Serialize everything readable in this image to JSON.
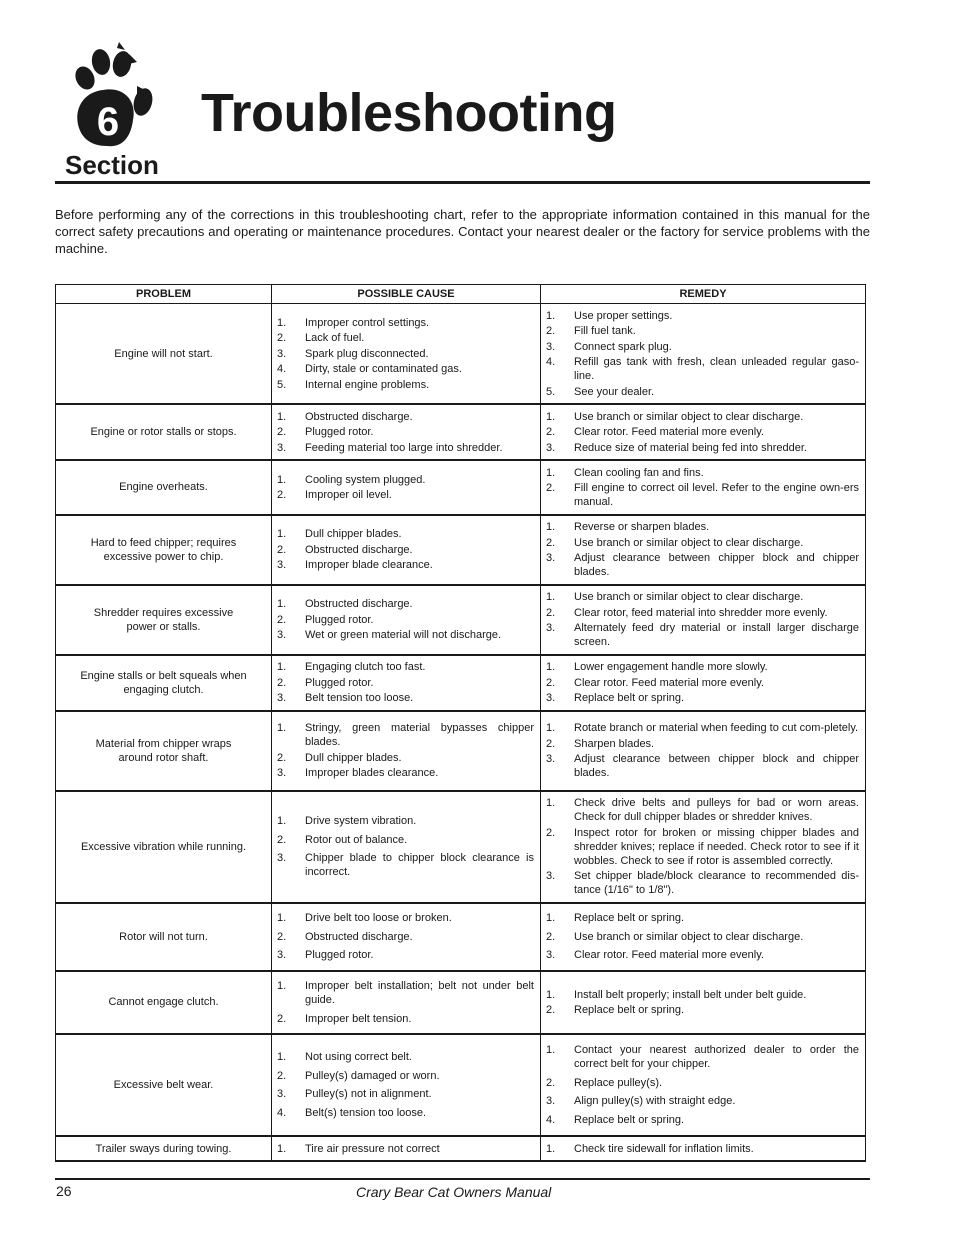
{
  "header": {
    "section_number": "6",
    "section_label": "Section",
    "title": "Troubleshooting"
  },
  "intro": "Before performing any of the corrections in this troubleshooting chart, refer to the appropriate information contained in this manual for the correct safety precautions and operating or maintenance procedures.  Contact your nearest dealer or the factory for service problems with the machine.",
  "table": {
    "headers": [
      "PROBLEM",
      "POSSIBLE CAUSE",
      "REMEDY"
    ],
    "rows": [
      {
        "problem": "Engine will not start.",
        "causes": [
          "Improper control settings.",
          "Lack of fuel.",
          "Spark plug disconnected.",
          "Dirty, stale or contaminated gas.",
          "Internal engine problems."
        ],
        "remedies": [
          "Use proper settings.",
          "Fill fuel tank.",
          "Connect spark plug.",
          "Refill gas tank with fresh, clean unleaded regular gaso-line.",
          "See your dealer."
        ]
      },
      {
        "problem": "Engine or rotor stalls or stops.",
        "causes": [
          "Obstructed discharge.",
          "Plugged rotor.",
          "Feeding material too large into shredder."
        ],
        "remedies": [
          "Use branch or similar object to clear discharge.",
          "Clear rotor.  Feed material more evenly.",
          "Reduce size of material being fed into shredder."
        ]
      },
      {
        "problem": "Engine overheats.",
        "causes": [
          "Cooling system plugged.",
          "Improper oil level."
        ],
        "remedies": [
          "Clean cooling fan and fins.",
          "Fill engine to correct oil level.  Refer to the engine own-ers manual."
        ]
      },
      {
        "problem": "Hard to feed chipper; requires excessive power to chip.",
        "causes": [
          "Dull chipper blades.",
          "Obstructed discharge.",
          "Improper blade clearance."
        ],
        "remedies": [
          "Reverse or sharpen blades.",
          "Use branch or similar object to clear discharge.",
          "Adjust clearance between chipper block and chipper blades."
        ]
      },
      {
        "problem": "Shredder requires excessive power or stalls.",
        "causes": [
          "Obstructed discharge.",
          "Plugged rotor.",
          "Wet or green material will not discharge."
        ],
        "remedies": [
          "Use branch or similar object to clear discharge.",
          "Clear rotor, feed material into shredder more evenly.",
          "Alternately feed dry material or install larger discharge screen."
        ]
      },
      {
        "problem": "Engine stalls or belt squeals when engaging clutch.",
        "causes": [
          "Engaging clutch too fast.",
          "Plugged rotor.",
          "Belt tension too loose."
        ],
        "remedies": [
          "Lower engagement handle more slowly.",
          "Clear rotor.  Feed material more evenly.",
          "Replace belt or spring."
        ]
      },
      {
        "problem": "Material from chipper wraps around rotor shaft.",
        "causes": [
          "Stringy, green material bypasses chipper blades.",
          "Dull chipper blades.",
          "Improper blades clearance."
        ],
        "remedies": [
          "Rotate branch or material when feeding to cut com-pletely.",
          "Sharpen blades.",
          "Adjust clearance between chipper block and chipper blades."
        ]
      },
      {
        "problem": "Excessive vibration while running.",
        "causes": [
          "Drive system vibration.",
          "Rotor out of balance.",
          "Chipper blade to chipper block clearance is incorrect."
        ],
        "remedies": [
          "Check drive belts and pulleys for bad or worn areas.  Check for dull chipper blades or shredder knives.",
          "Inspect rotor for broken or missing chipper blades and shredder knives; replace if needed.  Check rotor to see if it wobbles.  Check to see if rotor is assembled correctly.",
          "Set chipper blade/block clearance to recommended dis-tance (1/16\" to 1/8\")."
        ]
      },
      {
        "problem": "Rotor will not turn.",
        "causes": [
          "Drive belt too loose or broken.",
          "Obstructed discharge.",
          "Plugged rotor."
        ],
        "remedies": [
          "Replace belt or spring.",
          "Use branch or similar object to clear discharge.",
          "Clear rotor.  Feed material more evenly."
        ]
      },
      {
        "problem": "Cannot engage clutch.",
        "causes": [
          "Improper belt installation; belt not under belt guide.",
          "Improper belt tension."
        ],
        "remedies": [
          "Install belt properly; install belt under belt guide.",
          "Replace belt or spring."
        ]
      },
      {
        "problem": "Excessive belt wear.",
        "causes": [
          "Not using correct belt.",
          "Pulley(s) damaged or worn.",
          "Pulley(s) not in alignment.",
          "Belt(s) tension too loose."
        ],
        "remedies": [
          "Contact your nearest authorized dealer to order the correct belt for your chipper.",
          "Replace pulley(s).",
          "Align pulley(s) with straight edge.",
          "Replace belt or spring."
        ]
      },
      {
        "problem": "Trailer sways during towing.",
        "causes": [
          "Tire air pressure not correct"
        ],
        "remedies": [
          "Check tire sidewall for inflation limits."
        ]
      }
    ]
  },
  "footer": {
    "page_number": "26",
    "manual_title": "Crary Bear Cat Owners Manual"
  }
}
